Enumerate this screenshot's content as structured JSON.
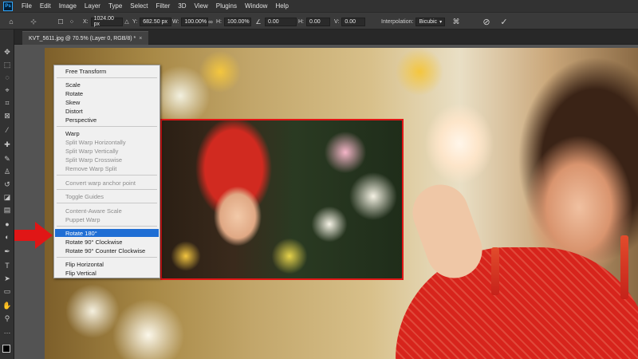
{
  "app": {
    "logo": "Ps"
  },
  "menubar": [
    "File",
    "Edit",
    "Image",
    "Layer",
    "Type",
    "Select",
    "Filter",
    "3D",
    "View",
    "Plugins",
    "Window",
    "Help"
  ],
  "options": {
    "x_label": "X:",
    "x_value": "1024.00 px",
    "y_label": "Y:",
    "y_value": "682.50 px",
    "w_label": "W:",
    "w_value": "100.00%",
    "h_label": "H:",
    "h_value": "100.00%",
    "angle_value": "0.00",
    "hskew_label": "H:",
    "hskew_value": "0.00",
    "vskew_label": "V:",
    "vskew_value": "0.00",
    "interp_label": "Interpolation:",
    "interp_value": "Bicubic",
    "cancel_icon": "⊘",
    "commit_icon": "✓"
  },
  "document": {
    "tab_title": "KVT_5611.jpg @ 70.5% (Layer 0, RGB/8) *",
    "close": "×"
  },
  "context_menu": {
    "items": [
      {
        "label": "Free Transform",
        "disabled": false
      },
      {
        "label": "Scale",
        "disabled": false
      },
      {
        "label": "Rotate",
        "disabled": false
      },
      {
        "label": "Skew",
        "disabled": false
      },
      {
        "label": "Distort",
        "disabled": false
      },
      {
        "label": "Perspective",
        "disabled": false
      },
      {
        "label": "Warp",
        "disabled": false
      },
      {
        "label": "Split Warp Horizontally",
        "disabled": true
      },
      {
        "label": "Split Warp Vertically",
        "disabled": true
      },
      {
        "label": "Split Warp Crosswise",
        "disabled": true
      },
      {
        "label": "Remove Warp Split",
        "disabled": true
      },
      {
        "label": "Convert warp anchor point",
        "disabled": true
      },
      {
        "label": "Toggle Guides",
        "disabled": true
      },
      {
        "label": "Content-Aware Scale",
        "disabled": true
      },
      {
        "label": "Puppet Warp",
        "disabled": true
      },
      {
        "label": "Rotate 180°",
        "highlighted": true
      },
      {
        "label": "Rotate 90° Clockwise",
        "disabled": false
      },
      {
        "label": "Rotate 90° Counter Clockwise",
        "disabled": false
      },
      {
        "label": "Flip Horizontal",
        "disabled": false
      },
      {
        "label": "Flip Vertical",
        "disabled": false
      }
    ]
  },
  "colors": {
    "highlight": "#1f6ed4",
    "annotation_red": "#e01616",
    "foreground": "#000000",
    "background": "#ffffff"
  }
}
